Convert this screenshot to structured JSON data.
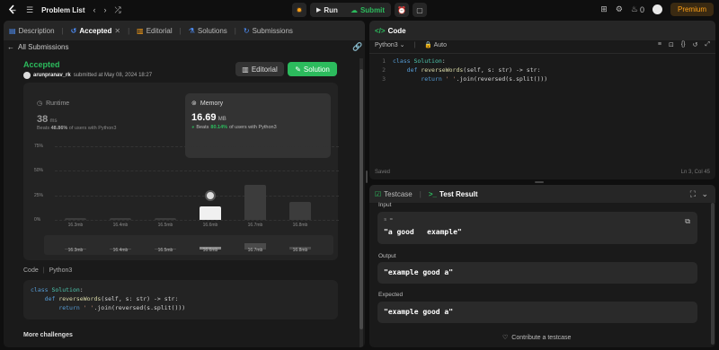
{
  "topbar": {
    "title": "Problem List",
    "run": "Run",
    "submit": "Submit",
    "streak": "0",
    "premium": "Premium"
  },
  "left_tabs": {
    "description": "Description",
    "accepted": "Accepted",
    "editorial": "Editorial",
    "solutions": "Solutions",
    "submissions": "Submissions"
  },
  "submission": {
    "back": "All Submissions",
    "status": "Accepted",
    "user": "arunpranav_rk",
    "submitted": "submitted at May 08, 2024 18:27",
    "editorial_btn": "Editorial",
    "solution_btn": "Solution",
    "runtime": {
      "label": "Runtime",
      "value": "38",
      "unit": "ms",
      "beats_prefix": "Beats",
      "beats": "48.86%",
      "beats_suffix": "of users with Python3"
    },
    "memory": {
      "label": "Memory",
      "value": "16.69",
      "unit": "MB",
      "beats_prefix": "Beats",
      "beats": "80.14%",
      "beats_suffix": "of users with Python3"
    },
    "code_label": "Code",
    "language": "Python3",
    "more": "More challenges"
  },
  "chart_data": {
    "type": "bar",
    "categories": [
      "16.3mb",
      "16.4mb",
      "16.5mb",
      "16.6mb",
      "16.7mb",
      "16.8mb"
    ],
    "values": [
      1,
      1,
      1,
      14,
      36,
      18
    ],
    "highlight": "16.6mb",
    "yticks": [
      "75%",
      "50%",
      "25%",
      "0%"
    ],
    "ylim": [
      0,
      75
    ]
  },
  "editor": {
    "title": "Code",
    "language": "Python3",
    "auto": "Auto",
    "saved": "Saved",
    "position": "Ln 3, Col 45"
  },
  "code_lines": [
    [
      [
        "kw",
        "class "
      ],
      [
        "cls",
        "Solution"
      ],
      [
        "pl",
        ":"
      ]
    ],
    [
      [
        "pl",
        "    "
      ],
      [
        "kw",
        "def "
      ],
      [
        "fn",
        "reverseWords"
      ],
      [
        "pl",
        "(self, s: str) -> str:"
      ]
    ],
    [
      [
        "pl",
        "        "
      ],
      [
        "kw",
        "return "
      ],
      [
        "str",
        "' '"
      ],
      [
        "pl",
        ".join(reversed(s.split()))"
      ]
    ]
  ],
  "testcase": {
    "tab1": "Testcase",
    "tab2": "Test Result",
    "input_label": "Input",
    "var": "s =",
    "input": "\"a good   example\"",
    "output_label": "Output",
    "output": "\"example good a\"",
    "expected_label": "Expected",
    "expected": "\"example good a\"",
    "contribute": "Contribute a testcase"
  },
  "colors": {
    "accent": "#2cbb5d",
    "orange": "#ffa116",
    "blue": "#4f91ff"
  }
}
